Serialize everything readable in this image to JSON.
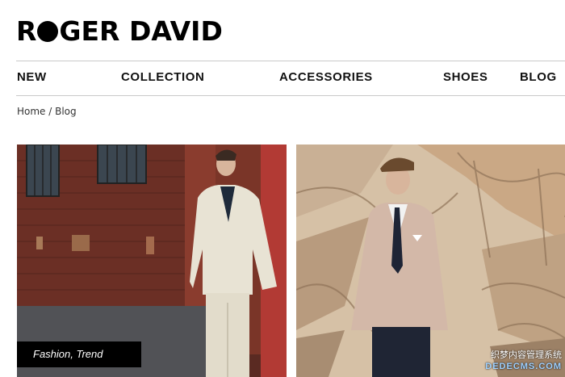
{
  "brand": {
    "logo_part1": "R",
    "logo_part2": "GER DAVID"
  },
  "nav": {
    "items": [
      {
        "label": "NEW"
      },
      {
        "label": "COLLECTION"
      },
      {
        "label": "ACCESSORIES"
      },
      {
        "label": "SHOES"
      },
      {
        "label": "BLOG"
      }
    ]
  },
  "breadcrumb": {
    "home": "Home",
    "separator": " / ",
    "current": "Blog"
  },
  "posts": [
    {
      "tag_label": "Fashion, Trend",
      "image_alt": "Man in cream suit against brick wall"
    },
    {
      "image_alt": "Man in pink blazer against sandstone rocks"
    }
  ],
  "watermark": {
    "line1": "织梦内容管理系统",
    "line2": "DEDECMS.COM"
  }
}
